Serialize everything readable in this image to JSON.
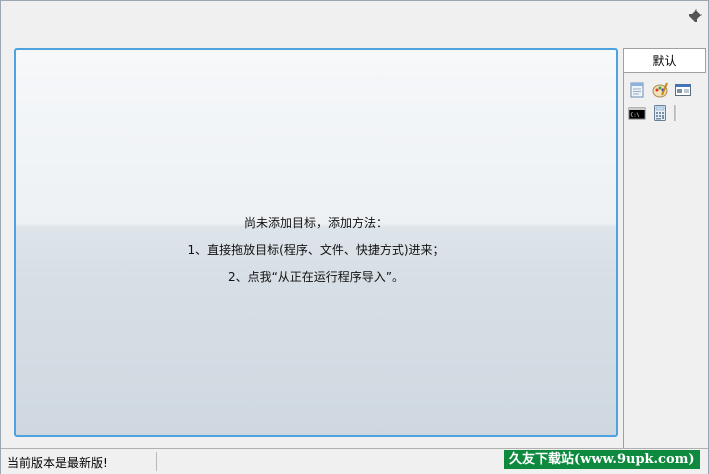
{
  "window": {
    "title": ""
  },
  "toolbar": {
    "pin_icon": "pin-icon"
  },
  "main": {
    "message_lines": [
      "尚未添加目标，添加方法：",
      "1、直接拖放目标(程序、文件、快捷方式)进来；",
      "2、点我“从正在运行程序导入”。"
    ],
    "border_color": "#4ca3dd"
  },
  "sidebar": {
    "tab_label": "默认",
    "icons": [
      "notepad-icon",
      "paint-icon",
      "system-info-icon",
      "cmd-icon",
      "calculator-icon"
    ]
  },
  "status": {
    "text": "当前版本是最新版!",
    "watermark": "久友下载站(www.9upk.com)"
  }
}
